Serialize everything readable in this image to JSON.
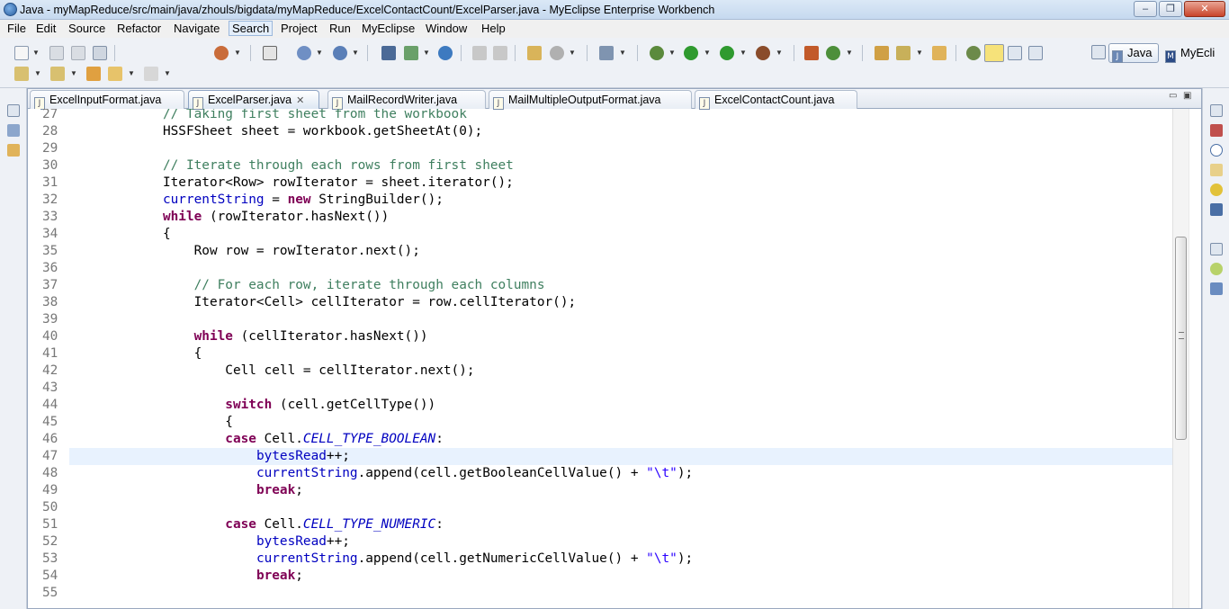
{
  "window": {
    "title": "Java - myMapReduce/src/main/java/zhouls/bigdata/myMapReduce/ExcelContactCount/ExcelParser.java - MyEclipse Enterprise Workbench",
    "minimize": "–",
    "maximize": "❐",
    "close": "✕"
  },
  "menu": [
    "File",
    "Edit",
    "Source",
    "Refactor",
    "Navigate",
    "Search",
    "Project",
    "Run",
    "MyEclipse",
    "Window",
    "Help"
  ],
  "perspectives": {
    "java": "Java",
    "myeclipse": "MyEcli"
  },
  "tabs": [
    {
      "label": "ExcelInputFormat.java",
      "active": false
    },
    {
      "label": "ExcelParser.java",
      "active": true
    },
    {
      "label": "MailRecordWriter.java",
      "active": false
    },
    {
      "label": "MailMultipleOutputFormat.java",
      "active": false
    },
    {
      "label": "ExcelContactCount.java",
      "active": false
    }
  ],
  "tab_icon": "J",
  "tab_close": "✕",
  "view_controls": {
    "minimize": "▭",
    "maximize": "▣"
  },
  "editor": {
    "current_line": 47,
    "lines": [
      {
        "n": "27",
        "text": "            // Taking first sheet from the workbook"
      },
      {
        "n": "28",
        "text": "            HSSFSheet sheet = workbook.getSheetAt(0);"
      },
      {
        "n": "29",
        "text": ""
      },
      {
        "n": "30",
        "text": "            // Iterate through each rows from first sheet"
      },
      {
        "n": "31",
        "text": "            Iterator<Row> rowIterator = sheet.iterator();"
      },
      {
        "n": "32",
        "text": "            currentString = new StringBuilder();"
      },
      {
        "n": "33",
        "text": "            while (rowIterator.hasNext())"
      },
      {
        "n": "34",
        "text": "            {"
      },
      {
        "n": "35",
        "text": "                Row row = rowIterator.next();"
      },
      {
        "n": "36",
        "text": ""
      },
      {
        "n": "37",
        "text": "                // For each row, iterate through each columns"
      },
      {
        "n": "38",
        "text": "                Iterator<Cell> cellIterator = row.cellIterator();"
      },
      {
        "n": "39",
        "text": ""
      },
      {
        "n": "40",
        "text": "                while (cellIterator.hasNext())"
      },
      {
        "n": "41",
        "text": "                {"
      },
      {
        "n": "42",
        "text": "                    Cell cell = cellIterator.next();"
      },
      {
        "n": "43",
        "text": ""
      },
      {
        "n": "44",
        "text": "                    switch (cell.getCellType())"
      },
      {
        "n": "45",
        "text": "                    {"
      },
      {
        "n": "46",
        "text": "                    case Cell.CELL_TYPE_BOOLEAN:"
      },
      {
        "n": "47",
        "text": "                        bytesRead++;"
      },
      {
        "n": "48",
        "text": "                        currentString.append(cell.getBooleanCellValue() + \"\\t\");"
      },
      {
        "n": "49",
        "text": "                        break;"
      },
      {
        "n": "50",
        "text": ""
      },
      {
        "n": "51",
        "text": "                    case Cell.CELL_TYPE_NUMERIC:"
      },
      {
        "n": "52",
        "text": "                        bytesRead++;"
      },
      {
        "n": "53",
        "text": "                        currentString.append(cell.getNumericCellValue() + \"\\t\");"
      },
      {
        "n": "54",
        "text": "                        break;"
      },
      {
        "n": "55",
        "text": ""
      }
    ]
  },
  "colors": {
    "keyword": "#7f0055",
    "comment": "#3f7f5f",
    "field": "#0000c0",
    "string": "#2a00ff",
    "current_line_bg": "#e8f2fe"
  }
}
